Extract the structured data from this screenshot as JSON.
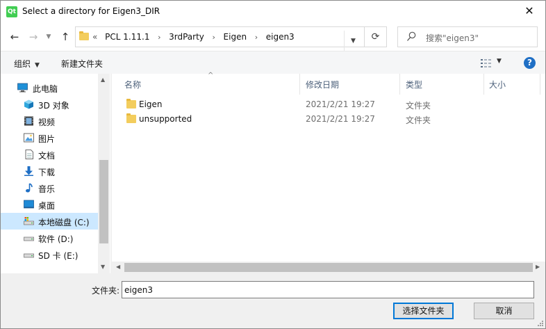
{
  "window": {
    "app_icon_text": "Qt",
    "title": "Select a directory for Eigen3_DIR",
    "close_glyph": "✕"
  },
  "nav": {
    "back_glyph": "←",
    "forward_glyph": "→",
    "recent_glyph": "▼",
    "up_glyph": "↑",
    "breadcrumb_overflow": "«",
    "breadcrumbs": [
      "PCL 1.11.1",
      "3rdParty",
      "Eigen",
      "eigen3"
    ],
    "breadcrumb_sep": "›",
    "address_dropdown_glyph": "▼",
    "refresh_glyph": "⟳",
    "search_placeholder": "搜索\"eigen3\""
  },
  "toolbar": {
    "organize_label": "组织",
    "organize_caret": "▼",
    "new_folder_label": "新建文件夹",
    "view_caret": "▼",
    "help_glyph": "?"
  },
  "sidebar": {
    "items": [
      {
        "label": "此电脑",
        "icon": "computer-icon"
      },
      {
        "label": "3D 对象",
        "icon": "3d-objects-icon"
      },
      {
        "label": "视频",
        "icon": "video-icon"
      },
      {
        "label": "图片",
        "icon": "pictures-icon"
      },
      {
        "label": "文档",
        "icon": "documents-icon"
      },
      {
        "label": "下载",
        "icon": "download-icon"
      },
      {
        "label": "音乐",
        "icon": "music-icon"
      },
      {
        "label": "桌面",
        "icon": "desktop-icon"
      },
      {
        "label": "本地磁盘 (C:)",
        "icon": "drive-c-icon",
        "selected": true
      },
      {
        "label": "软件 (D:)",
        "icon": "drive-icon"
      },
      {
        "label": "SD 卡 (E:)",
        "icon": "drive-icon"
      }
    ],
    "scroll_up_glyph": "▲",
    "scroll_down_glyph": "▼"
  },
  "filelist": {
    "columns": [
      "名称",
      "修改日期",
      "类型",
      "大小"
    ],
    "sort_glyph": "^",
    "rows": [
      {
        "name": "Eigen",
        "date": "2021/2/21 19:27",
        "type": "文件夹"
      },
      {
        "name": "unsupported",
        "date": "2021/2/21 19:27",
        "type": "文件夹"
      }
    ],
    "scroll_left_glyph": "◀",
    "scroll_right_glyph": "▶"
  },
  "bottom": {
    "folder_label": "文件夹:",
    "folder_value": "eigen3",
    "select_button": "选择文件夹",
    "cancel_button": "取消"
  },
  "colors": {
    "accent": "#0078d7",
    "selection": "#cce8ff",
    "folder": "#f3cd5d",
    "help": "#1f6fc5",
    "qt_green": "#41cd52"
  }
}
